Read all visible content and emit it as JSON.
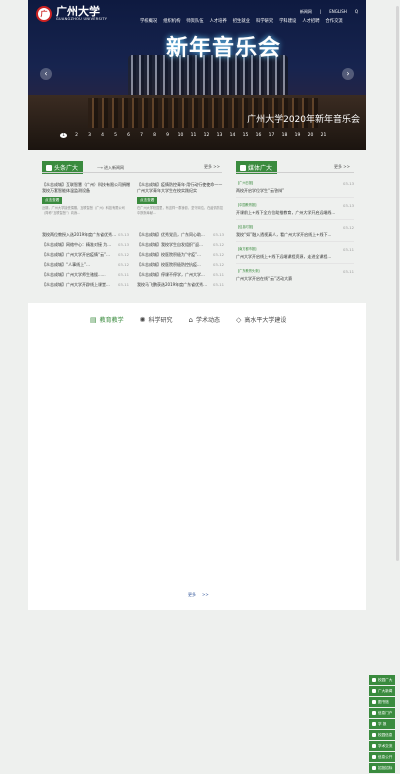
{
  "header": {
    "logo_text": "广州大学",
    "logo_en": "GUANGZHOU UNIVERSITY",
    "seal": "广",
    "top_links": [
      "新闻网",
      "|",
      "ENGLISH",
      "Q"
    ],
    "nav": [
      "学校概况",
      "组织机构",
      "师资队伍",
      "人才培养",
      "招生就业",
      "科学研究",
      "学科建设",
      "人才招聘",
      "合作交流"
    ]
  },
  "banner": {
    "headline": "新年音乐会",
    "caption": "广州大学2020年新年音乐会",
    "prev": "‹",
    "next": "›",
    "pages": [
      "1",
      "2",
      "3",
      "4",
      "5",
      "6",
      "7",
      "8",
      "9",
      "10",
      "11",
      "12",
      "13",
      "14",
      "15",
      "16",
      "17",
      "18",
      "19",
      "20",
      "21"
    ]
  },
  "news": {
    "title": "头条广大",
    "sub": "进入新闻网",
    "more": "更多 >>",
    "feature1": {
      "title": "【众志成城】互联智慧（广州）科技有限公司捐赠我校万套智能体温监测设备",
      "pill": "点击查看",
      "summary": "近期，广州大学接受捐赠，互联智慧（广州）科技有限公司（简称“互联智慧”）向我..."
    },
    "feature2": {
      "title": "【众志成城】疫情防控青年·用行动行使使命——广州大学青年大学生在校实践纪实",
      "pill": "点击查看",
      "summary": "在广州大学校园里，有这样一群身影，坚守岗位，在疫情防控中默默奉献..."
    },
    "left_list": [
      {
        "t": "我校两位教授入选2019年度广东省优秀...",
        "d": "03-13"
      },
      {
        "t": "【众志成城】网络中心：精准对接 为...",
        "d": "03-13"
      },
      {
        "t": "【众志成城】广州大学开启疫情“云”...",
        "d": "03-12"
      },
      {
        "t": "【众志成城】“人事线上”...",
        "d": "03-12"
      },
      {
        "t": "【众志成城】广州大学师生驰援......",
        "d": "03-11"
      },
      {
        "t": "【众志成城】广州大学开辟线上课堂...",
        "d": "03-11"
      }
    ],
    "right_list": [
      {
        "t": "【众志成城】优秀党员，广东同心助...",
        "d": "03-13"
      },
      {
        "t": "【众志成城】我校学生自发组织“返...",
        "d": "03-12"
      },
      {
        "t": "【众志成城】校医院积极为“守疫”...",
        "d": "03-12"
      },
      {
        "t": "【众志成城】校医院积极防控抗疫...",
        "d": "03-12"
      },
      {
        "t": "【众志成城】停课不停学，广州大学...",
        "d": "03-11"
      },
      {
        "t": "我校马飞鹏获选2019年度广东省优秀...",
        "d": "03-11"
      }
    ]
  },
  "media": {
    "title": "媒体广大",
    "more": "更多 >>",
    "items": [
      {
        "src": "【广州日报】",
        "t": "两校开启学位学生“云答辩”",
        "d": "03-13"
      },
      {
        "src": "【中国教育报】",
        "t": "开课前上+线下全方位助推教育，广州大学开启远端线...",
        "d": "03-13"
      },
      {
        "src": "【信息时报】",
        "t": "我校“如”融入透视真人，看广州大学开启线上+线下...",
        "d": "03-12"
      },
      {
        "src": "【南方都市报】",
        "t": "广州大学开启线上+线下远端课程资源，走进全课程...",
        "d": "03-11"
      },
      {
        "src": "【广东教育头条】",
        "t": "广州大学开启在线“云”活动大赛",
        "d": "03-11"
      }
    ]
  },
  "tabs": {
    "items": [
      {
        "label": "教育教学",
        "icon": "book-icon",
        "sym": "▤"
      },
      {
        "label": "科学研究",
        "icon": "gear-icon",
        "sym": "✺"
      },
      {
        "label": "学术动态",
        "icon": "scholar-icon",
        "sym": "⌂"
      },
      {
        "label": "高水平大学建设",
        "icon": "diamond-icon",
        "sym": "◇"
      }
    ],
    "pager": [
      "更多",
      "&gt;&gt;"
    ]
  },
  "sidebar": [
    {
      "label": "校园广大",
      "icon": "campus-icon"
    },
    {
      "label": "广大新闻",
      "icon": "news-icon"
    },
    {
      "label": "图书馆",
      "icon": "library-icon"
    },
    {
      "label": "信息门户",
      "icon": "portal-icon"
    },
    {
      "label": "学 报",
      "icon": "journal-icon"
    },
    {
      "label": "校园信息",
      "icon": "info-icon"
    },
    {
      "label": "学术交流",
      "icon": "exchange-icon"
    },
    {
      "label": "信息公开",
      "icon": "public-icon"
    },
    {
      "label": "招投招标",
      "icon": "tender-icon"
    }
  ]
}
